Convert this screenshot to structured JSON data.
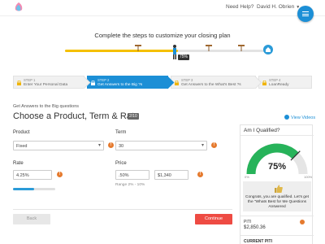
{
  "header": {
    "need_help": "Need Help?",
    "user_name": "David H. Obrien"
  },
  "headline": "Complete the steps to customize your closing plan",
  "progress": {
    "percent_label": "75%",
    "fill_fraction": 0.56
  },
  "steps": [
    {
      "number": "STEP 1",
      "label": "Enter Your Personal Data",
      "state": "locked"
    },
    {
      "number": "STEP 2",
      "label": "Get Answers to the  Big ?s",
      "state": "active"
    },
    {
      "number": "STEP 3",
      "label": "Get Answers to the  What's Best ?s",
      "state": "locked"
    },
    {
      "number": "STEP 4",
      "label": "LoanReady",
      "state": "locked"
    }
  ],
  "form": {
    "sub_caption": "Get Answers to the Big questions",
    "title": "Choose a Product, Term & Rate",
    "counter": "2/10",
    "view_videos": "View Videos",
    "product": {
      "label": "Product",
      "value": "Fixed"
    },
    "term": {
      "label": "Term",
      "value": "30"
    },
    "rate": {
      "label": "Rate",
      "value": "4.25%",
      "slider_fraction": 0.5
    },
    "price": {
      "label": "Price",
      "percent_value": ".50%",
      "dollar_value": "$1,340",
      "range_note": "Range 2% - 10%"
    },
    "back_label": "Back",
    "continue_label": "Continue"
  },
  "qualify": {
    "title": "Am I Qualified?",
    "gauge_value": "75%",
    "gauge_fraction": 0.75,
    "gauge_min": "0%",
    "gauge_max": "100%",
    "message": "Congrats, you are qualified. Let's get the \"Whats Best for Me Questions Answered",
    "piti_label": "PITI",
    "piti_value": "$2,850.36",
    "current_piti_label": "CURRENT PITI"
  },
  "colors": {
    "brand_blue": "#1c8fd6",
    "progress_yellow": "#f5c000",
    "gauge_green": "#27b35a",
    "continue_red": "#ee4b43",
    "info_orange": "#e57a2e"
  },
  "icons": {
    "logo": "logo-icon",
    "menu": "hamburger-icon",
    "lock": "lock-icon",
    "info": "info-icon",
    "play": "play-icon",
    "thumb": "thumbs-up-icon",
    "house": "house-icon"
  }
}
